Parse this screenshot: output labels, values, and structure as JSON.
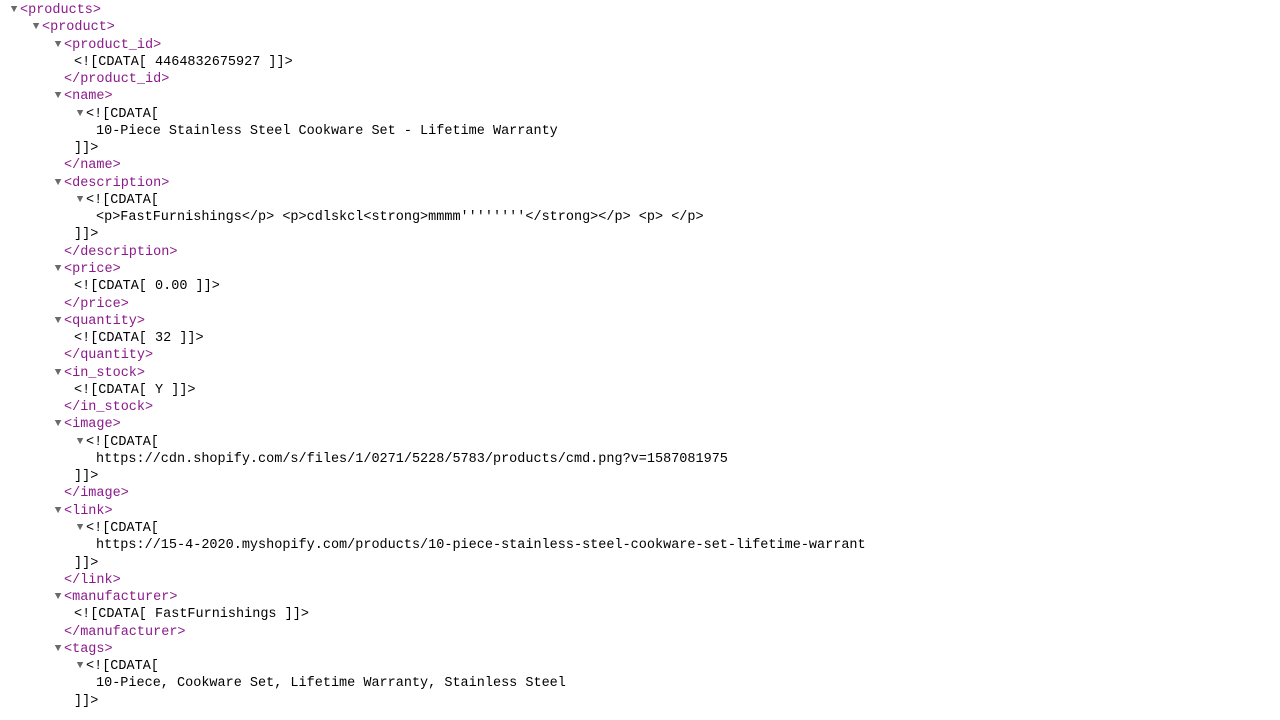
{
  "arrow": "▼",
  "root": {
    "open": "<products>",
    "product_open": "<product>",
    "product_id": {
      "open": "<product_id>",
      "cdata": "<![CDATA[ 4464832675927 ]]>",
      "close": "</product_id>"
    },
    "name": {
      "open": "<name>",
      "cdata_open": "<![CDATA[",
      "value": "10-Piece Stainless Steel Cookware Set - Lifetime Warranty",
      "cdata_close": "]]>",
      "close": "</name>"
    },
    "description": {
      "open": "<description>",
      "cdata_open": "<![CDATA[",
      "value": "<p>FastFurnishings</p> <p>cdlskcl<strong>mmmm''''''''</strong></p> <p> </p>",
      "cdata_close": "]]>",
      "close": "</description>"
    },
    "price": {
      "open": "<price>",
      "cdata": "<![CDATA[ 0.00 ]]>",
      "close": "</price>"
    },
    "quantity": {
      "open": "<quantity>",
      "cdata": "<![CDATA[ 32 ]]>",
      "close": "</quantity>"
    },
    "in_stock": {
      "open": "<in_stock>",
      "cdata": "<![CDATA[ Y ]]>",
      "close": "</in_stock>"
    },
    "image": {
      "open": "<image>",
      "cdata_open": "<![CDATA[",
      "value": "https://cdn.shopify.com/s/files/1/0271/5228/5783/products/cmd.png?v=1587081975",
      "cdata_close": "]]>",
      "close": "</image>"
    },
    "link": {
      "open": "<link>",
      "cdata_open": "<![CDATA[",
      "value": "https://15-4-2020.myshopify.com/products/10-piece-stainless-steel-cookware-set-lifetime-warrant",
      "cdata_close": "]]>",
      "close": "</link>"
    },
    "manufacturer": {
      "open": "<manufacturer>",
      "cdata": "<![CDATA[ FastFurnishings ]]>",
      "close": "</manufacturer>"
    },
    "tags": {
      "open": "<tags>",
      "cdata_open": "<![CDATA[",
      "value": "10-Piece, Cookware Set, Lifetime Warranty, Stainless Steel",
      "cdata_close": "]]>"
    }
  }
}
